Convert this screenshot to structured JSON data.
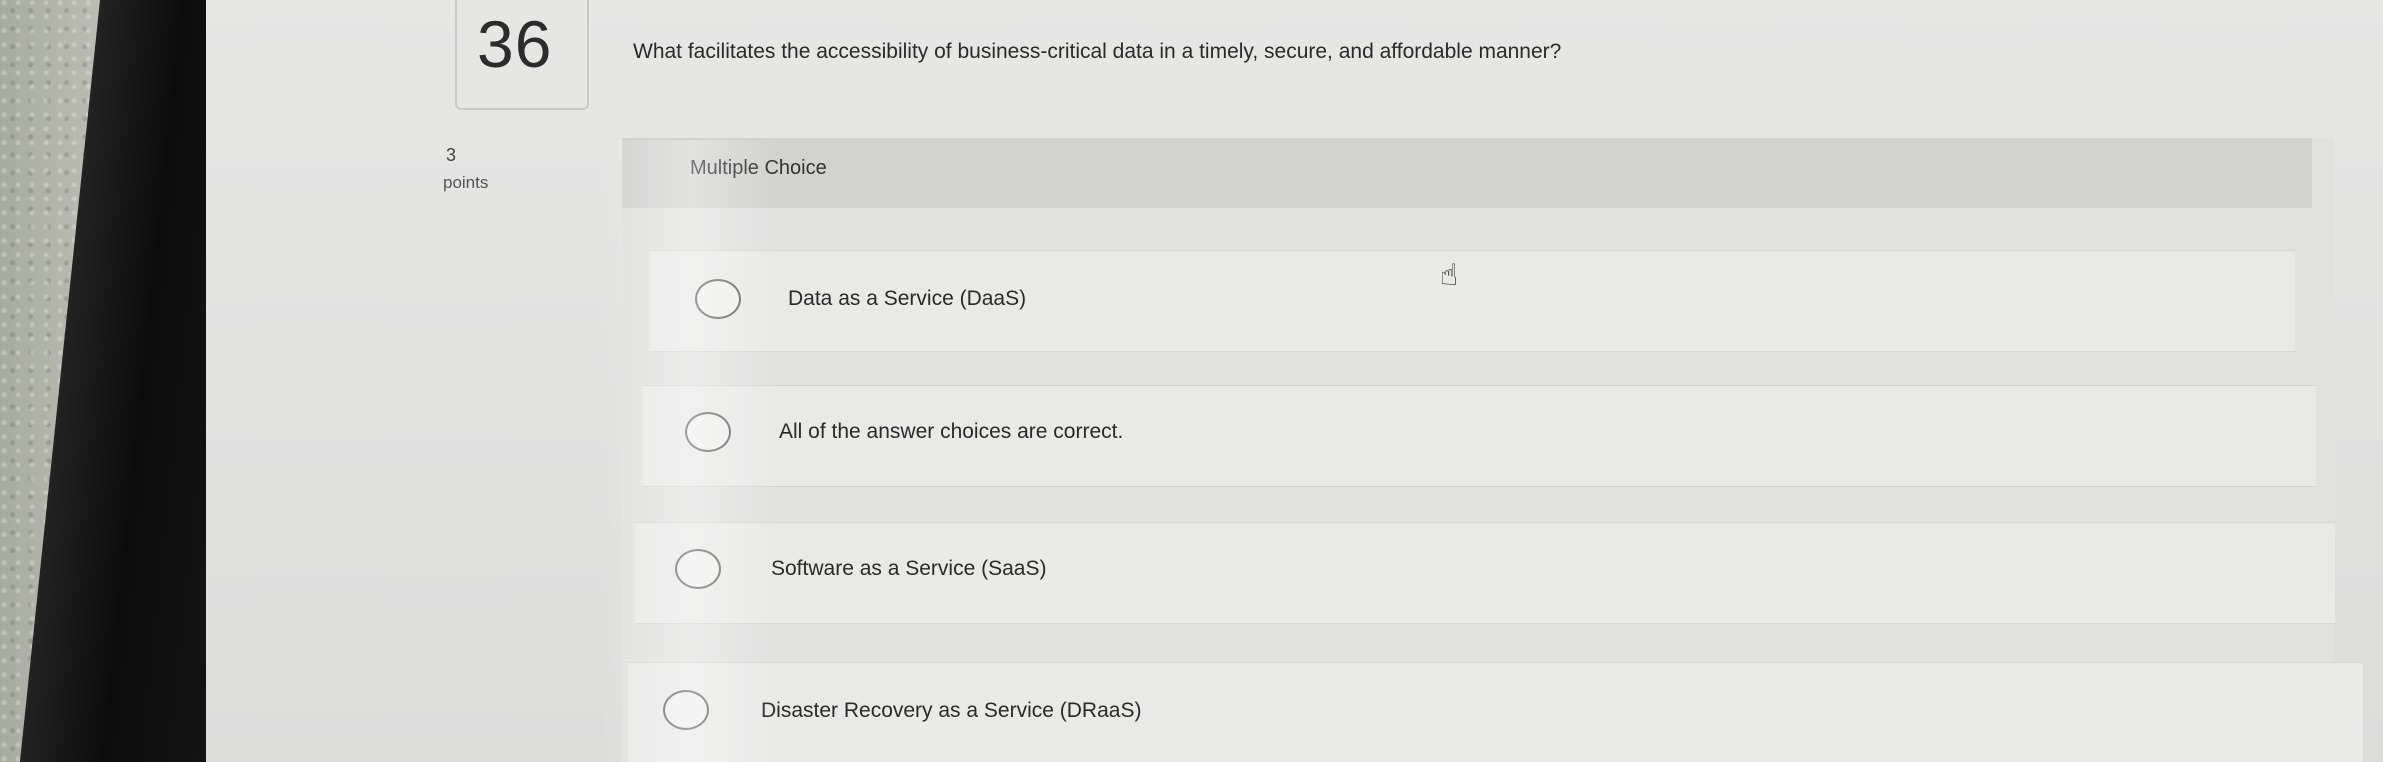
{
  "question": {
    "number": "36",
    "text": "What facilitates the accessibility of business-critical data in a timely, secure, and affordable manner?",
    "points_value": "3",
    "points_label": "points"
  },
  "answer_block": {
    "type_label": "Multiple Choice",
    "options": [
      {
        "label": "Data as a Service (DaaS)"
      },
      {
        "label": "All of the answer choices are correct."
      },
      {
        "label": "Software as a Service (SaaS)"
      },
      {
        "label": "Disaster Recovery as a Service (DRaaS)"
      }
    ]
  },
  "icons": {
    "cursor": "hand-pointer-icon",
    "option_radio": "radio-unchecked-icon"
  }
}
